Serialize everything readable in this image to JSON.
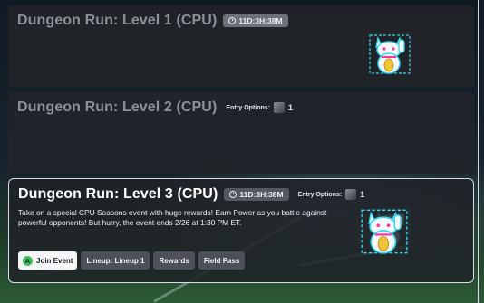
{
  "events": [
    {
      "title": "Dungeon Run: Level 1 (CPU)",
      "timer": "11D:3H:38M"
    },
    {
      "title": "Dungeon Run: Level 2 (CPU)",
      "entry_label": "Entry Options:",
      "entry_count": "1"
    },
    {
      "title": "Dungeon Run: Level 3 (CPU)",
      "timer": "11D:3H:38M",
      "entry_label": "Entry Options:",
      "entry_count": "1",
      "description": "Take on a special CPU Seasons event with huge rewards! Earn Power as you battle against powerful opponents! But hurry, the event ends 2/26 at 1:30 PM ET.",
      "buttons": {
        "join_icon": "A",
        "join": "Join Event",
        "lineup": "Lineup: Lineup 1",
        "rewards": "Rewards",
        "field_pass": "Field Pass"
      }
    }
  ],
  "icons": {
    "timer": "clock-icon",
    "entry": "entry-token-icon",
    "mascot": "lucky-cat-icon",
    "join": "a-button-icon"
  },
  "colors": {
    "join_badge": "#3fbf5a",
    "active_border": "#d9dde3",
    "mascot_outline": "#35d8f0",
    "mascot_coin": "#f2c536",
    "mascot_accent": "#f03aa0"
  }
}
